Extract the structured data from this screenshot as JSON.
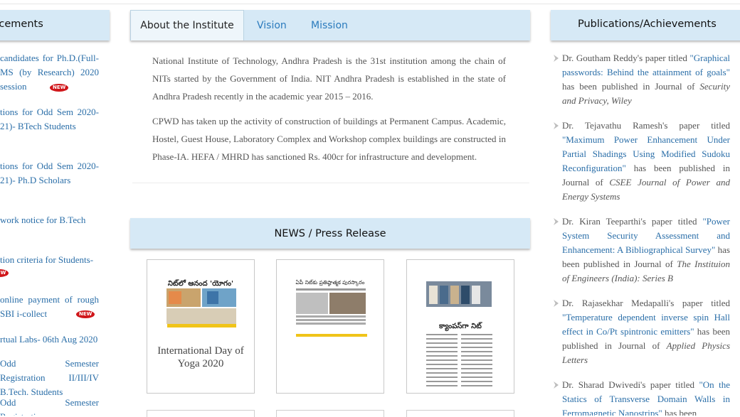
{
  "announcements": {
    "header": "uncements",
    "items": [
      {
        "text": "candidates for Ph.D.(Full- MS (by Research) 2020 session",
        "new": true
      },
      {
        "text": "tions for Odd Sem 2020-21)- BTech Students",
        "new": false
      },
      {
        "text": "tions for Odd Sem 2020-21)- Ph.D Scholars",
        "new": false
      },
      {
        "text": "work notice for B.Tech",
        "new": false
      },
      {
        "text": "tion criteria for Students-",
        "new": true
      },
      {
        "text": "online payment of rough SBI i-collect",
        "new": true
      },
      {
        "text": "rtual Labs- 06th Aug 2020",
        "new": false
      },
      {
        "text": "Odd Semester Registration II/III/IV B.Tech. Students",
        "new": false
      },
      {
        "text": "Odd Semester Registration",
        "new": false
      }
    ],
    "new_badge": "NEW"
  },
  "tabs": [
    {
      "label": "About the Institute",
      "active": true
    },
    {
      "label": "Vision",
      "active": false
    },
    {
      "label": "Mission",
      "active": false
    }
  ],
  "about": {
    "p1": "National Institute of Technology, Andhra Pradesh is the 31st institution among the chain of NITs started by the Government of India. NIT Andhra Pradesh is established in the state of Andhra Pradesh recently in the academic year 2015 – 2016.",
    "p2": "CPWD has taken up the activity of construction of buildings at Permanent Campus. Academic, Hostel, Guest House, Laboratory Complex and Workshop complex buildings are constructed in Phase-IA. HEFA / MHRD has sanctioned Rs. 400cr for infrastructure and development."
  },
  "news": {
    "header": "NEWS / Press Release",
    "cards": [
      {
        "caption": "International Day of Yoga 2020",
        "headline": "నిట్‌లో ఆనంద 'యోగం'"
      },
      {
        "caption": "",
        "headline": "ఏపీ నిట్‌కు ప్రతిష్ఠాత్మక పురస్కారం"
      },
      {
        "caption": "",
        "headline": "క్యాంపస్‌గా నిట్"
      }
    ]
  },
  "publications": {
    "header": "Publications/Achievements",
    "items": [
      {
        "pre": "Dr. Goutham Reddy's paper titled ",
        "title": "\"Graphical passwords: Behind the attainment of goals\"",
        "mid": " has been published in Journal of ",
        "journal": "Security and Privacy, Wiley"
      },
      {
        "pre": "Dr. Tejavathu Ramesh's paper titled ",
        "title": "\"Maximum Power Enhancement Under Partial Shadings Using Modified Sudoku Reconfiguration\"",
        "mid": " has been published in Journal of ",
        "journal": "CSEE Journal of Power and Energy Systems"
      },
      {
        "pre": "Dr. Kiran Teeparthi's paper titled ",
        "title": "\"Power System Security Assessment and Enhancement: A Bibliographical Survey\"",
        "mid": " has been published in Journal of ",
        "journal": "The Instituion of Engineers (India): Series B"
      },
      {
        "pre": "Dr. Rajasekhar Medapalli's paper titled ",
        "title": "\"Temperature dependent inverse spin Hall effect in Co/Pt spintronic emitters\"",
        "mid": " has been published in Journal of ",
        "journal": "Applied Physics Letters"
      },
      {
        "pre": "Dr. Sharad Dwivedi's paper titled ",
        "title": "\"On the Statics of Transverse Domain Walls in Ferromagnetic Nanostrips\"",
        "mid": " has been",
        "journal": ""
      }
    ]
  },
  "colors": {
    "header_bg": "#d6e9f6",
    "link": "#2a6ea8",
    "tab_link": "#2b7bbd",
    "badge": "#d0161a"
  }
}
